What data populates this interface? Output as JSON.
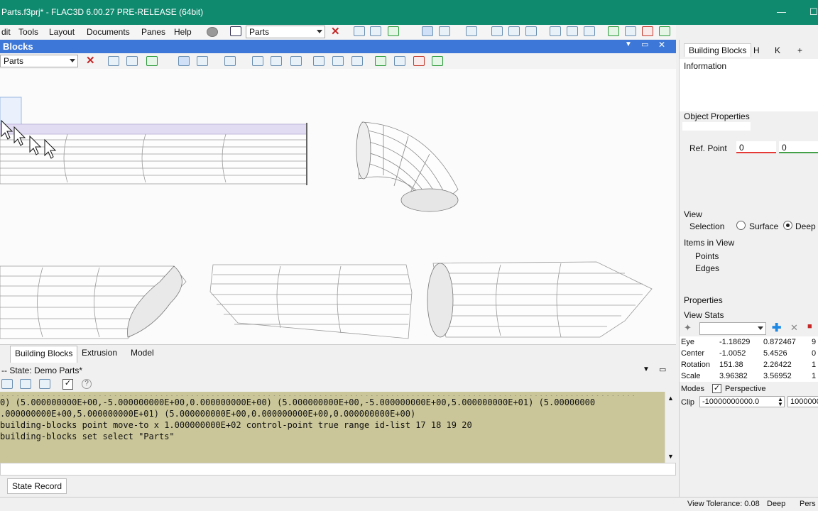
{
  "window": {
    "title": "Parts.f3prj* - FLAC3D 6.00.27 PRE-RELEASE (64bit)",
    "minimize": "—",
    "maximize": "☐"
  },
  "menu": {
    "items": [
      "dit",
      "Tools",
      "Layout",
      "Documents",
      "Panes",
      "Help"
    ],
    "parts_combo": "Parts"
  },
  "pane": {
    "title": "Blocks",
    "view_combo": "Parts"
  },
  "bottom_tabs": [
    "Building Blocks",
    "Extrusion",
    "Model"
  ],
  "console": {
    "title": "-- State: Demo Parts*",
    "lines": [
      "0) (5.000000000E+00,-5.000000000E+00,0.000000000E+00) (5.000000000E+00,-5.000000000E+00,5.000000000E+01) (5.00000000",
      ".000000000E+00,5.000000000E+01) (5.000000000E+00,0.000000000E+00,0.000000000E+00)",
      "building-blocks point move-to x 1.000000000E+02 control-point true range id-list 17 18 19 20",
      "building-blocks set select \"Parts\""
    ],
    "help_glyph": "?"
  },
  "state_record": "State Record",
  "right": {
    "tabs": [
      "Building Blocks",
      "H",
      "K",
      "+"
    ],
    "information": "Information",
    "object_properties": "Object Properties",
    "ref_point_label": "Ref. Point",
    "ref_point_x": "0",
    "ref_point_y": "0",
    "view": "View",
    "selection_label": "Selection",
    "surface_label": "Surface",
    "deep_label": "Deep",
    "items_in_view": "Items in View",
    "points": "Points",
    "edges": "Edges",
    "properties": "Properties",
    "view_stats": "View Stats",
    "stats": [
      {
        "label": "Eye",
        "v1": "-1.18629",
        "v2": "0.872467",
        "v3": "9"
      },
      {
        "label": "Center",
        "v1": "-1.0052",
        "v2": "5.4526",
        "v3": "0"
      },
      {
        "label": "Rotation",
        "v1": "151.38",
        "v2": "2.26422",
        "v3": "1"
      },
      {
        "label": "Scale",
        "v1": "3.96382",
        "v2": "3.56952",
        "v3": "1"
      }
    ],
    "modes_label": "Modes",
    "perspective_label": "Perspective",
    "clip_label": "Clip",
    "clip_near": "-10000000000.0",
    "clip_far": "1000000"
  },
  "status": {
    "tolerance": "View Tolerance: 0.08",
    "mode": "Deep",
    "persp": "Pers"
  },
  "colors": {
    "title_bar": "#0f8a6f",
    "pane_title": "#3d78d8",
    "console_bg": "#cac699",
    "accent_red": "#c62828"
  }
}
